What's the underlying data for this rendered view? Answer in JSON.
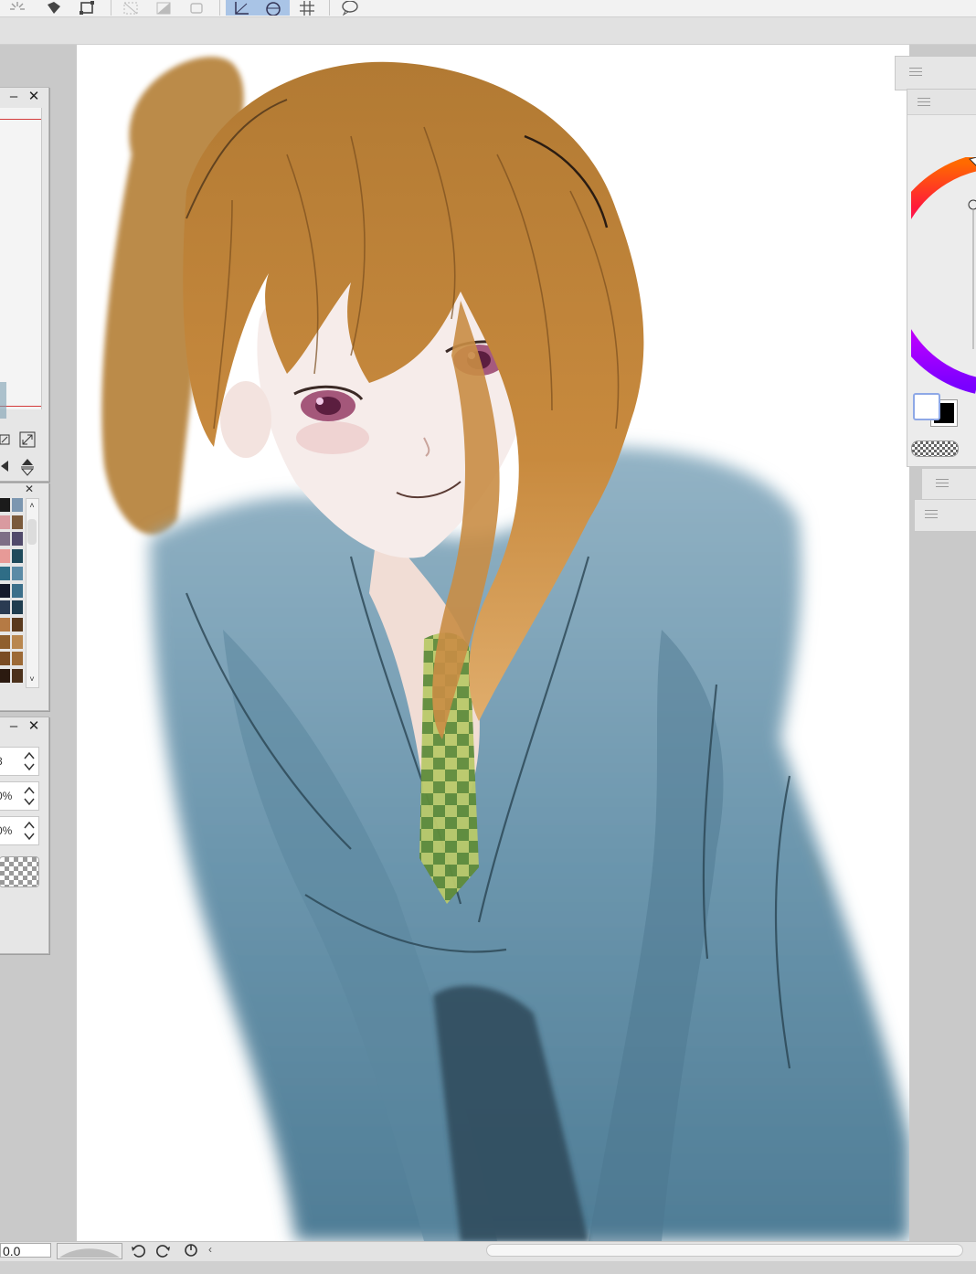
{
  "status_bar": {
    "zoom_value": "0.0"
  },
  "tool_property": {
    "value_1": "8",
    "value_2": "0%",
    "value_3": "0%"
  },
  "colors": {
    "canvas_bg": "#ffffff",
    "workspace_bg": "#c9c9c9",
    "toolbar_selected": "#a9c4e6",
    "main_color": "#ffffff",
    "sub_color": "#000000",
    "ruler_line": "#d33b3b"
  },
  "color_set": {
    "swatches": [
      [
        "#1b1b1b",
        "#7b96b0"
      ],
      [
        "#d99aa0",
        "#7a5a3c"
      ],
      [
        "#7d6f86",
        "#514a6b"
      ],
      [
        "#e79a97",
        "#1e4a5b"
      ],
      [
        "#2f6d86",
        "#5b8ba6"
      ],
      [
        "#151a2b",
        "#3b6f8a"
      ],
      [
        "#2a3b52",
        "#1f3d4f"
      ],
      [
        "#b57a44",
        "#5a3a1e"
      ],
      [
        "#8f5f2e",
        "#b9874f"
      ],
      [
        "#7a4c24",
        "#9d6a36"
      ],
      [
        "#2b1a10",
        "#4c311b"
      ]
    ]
  },
  "icons": {
    "toolbar": [
      "sparkle-icon",
      "fill-icon",
      "transform-icon",
      "deselect-icon",
      "invert-icon",
      "selection-outline-icon",
      "ruler-icon",
      "perspective-icon",
      "grid-icon",
      "balloon-icon"
    ],
    "panels": [
      "minimize-icon",
      "close-icon",
      "hamburger-icon"
    ],
    "bottom": [
      "undo-icon",
      "redo-icon",
      "rotate-reset-icon",
      "scroll-left-icon"
    ]
  }
}
